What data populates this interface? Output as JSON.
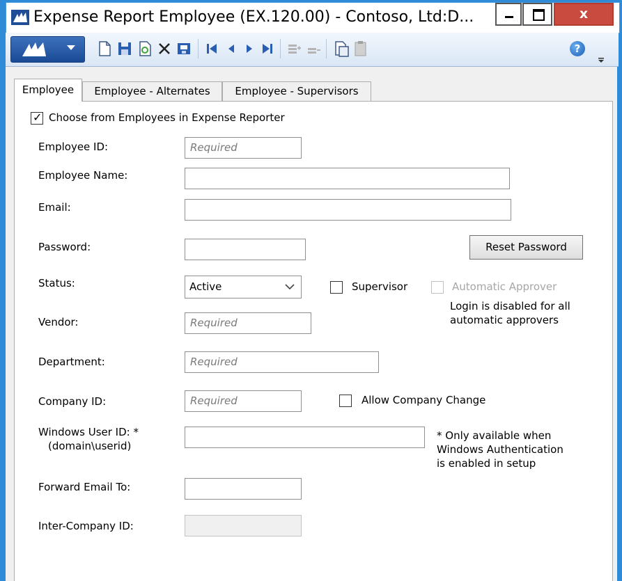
{
  "window": {
    "title": "Expense Report Employee (EX.120.00) - Contoso, Ltd:D...",
    "controls": {
      "minimize": "",
      "maximize": "",
      "close": "x"
    }
  },
  "toolbar": {
    "icons": [
      "new-icon",
      "save-icon",
      "refresh-icon",
      "delete-icon",
      "print-icon",
      "first-record-icon",
      "previous-record-icon",
      "next-record-icon",
      "last-record-icon",
      "insert-row-icon",
      "delete-row-icon",
      "copy-icon",
      "paste-icon",
      "help-icon"
    ],
    "help_label": "?"
  },
  "tabs": [
    {
      "label": "Employee",
      "active": true
    },
    {
      "label": "Employee - Alternates",
      "active": false
    },
    {
      "label": "Employee - Supervisors",
      "active": false
    }
  ],
  "form": {
    "choose_from_employees": {
      "label": "Choose from Employees in Expense Reporter",
      "checked": true
    },
    "employee_id": {
      "label": "Employee ID:",
      "placeholder": "Required",
      "value": ""
    },
    "employee_name": {
      "label": "Employee Name:",
      "value": ""
    },
    "email": {
      "label": "Email:",
      "value": ""
    },
    "password": {
      "label": "Password:",
      "value": ""
    },
    "reset_password": {
      "label": "Reset Password"
    },
    "status": {
      "label": "Status:",
      "value": "Active"
    },
    "supervisor": {
      "label": "Supervisor",
      "checked": false
    },
    "automatic_approver": {
      "label": "Automatic Approver",
      "checked": false,
      "enabled": false
    },
    "approver_note_line1": "Login is disabled for all",
    "approver_note_line2": "automatic approvers",
    "vendor": {
      "label": "Vendor:",
      "placeholder": "Required",
      "value": ""
    },
    "department": {
      "label": "Department:",
      "placeholder": "Required",
      "value": ""
    },
    "company_id": {
      "label": "Company ID:",
      "placeholder": "Required",
      "value": ""
    },
    "allow_company_change": {
      "label": "Allow Company Change",
      "checked": false
    },
    "windows_user_id": {
      "label_line1": "Windows User ID: *",
      "label_line2": "(domain\\userid)",
      "value": ""
    },
    "windows_note_line1": "* Only available when",
    "windows_note_line2": "Windows Authentication",
    "windows_note_line3": "is enabled in setup",
    "forward_email_to": {
      "label": "Forward Email To:",
      "value": ""
    },
    "inter_company_id": {
      "label": "Inter-Company ID:",
      "value": "",
      "enabled": false
    }
  },
  "colors": {
    "window_frame": "#2f8ad8",
    "close_button": "#c94a3e",
    "toolbar_bg": "#dce8f6",
    "brand": "#1a4a96"
  }
}
